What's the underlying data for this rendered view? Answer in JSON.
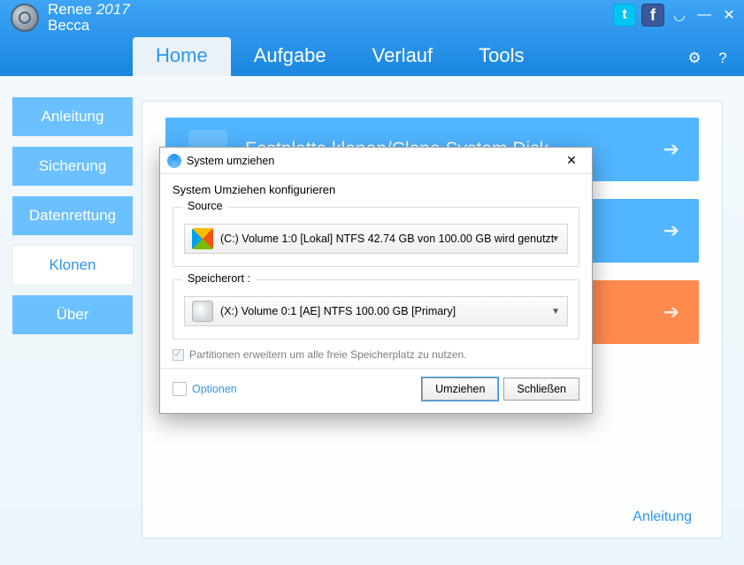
{
  "brand": {
    "name1": "Renee",
    "year": "2017",
    "name2": "Becca"
  },
  "tabs": {
    "home": "Home",
    "aufgabe": "Aufgabe",
    "verlauf": "Verlauf",
    "tools": "Tools"
  },
  "sidebar": {
    "anleitung": "Anleitung",
    "sicherung": "Sicherung",
    "datenrettung": "Datenrettung",
    "klonen": "Klonen",
    "ueber": "Über"
  },
  "tasks": {
    "clone": "Festplatte klonen/Clone System Disk",
    "t2": "",
    "t3": ""
  },
  "help_link": "Anleitung",
  "dialog": {
    "title": "System umziehen",
    "subtitle": "System Umziehen konfigurieren",
    "group_source": "Source",
    "source_text": "(C:) Volume 1:0 [Lokal]   NTFS   42.74 GB von 100.00 GB wird genutzt",
    "group_target": "Speicherort :",
    "target_text": "(X:) Volume 0:1 [AE]   NTFS   100.00 GB [Primary]",
    "checkbox": "Partitionen erweitern um alle freie Speicherplatz zu nutzen.",
    "options": "Optionen",
    "btn_primary": "Umziehen",
    "btn_close": "Schließen"
  }
}
